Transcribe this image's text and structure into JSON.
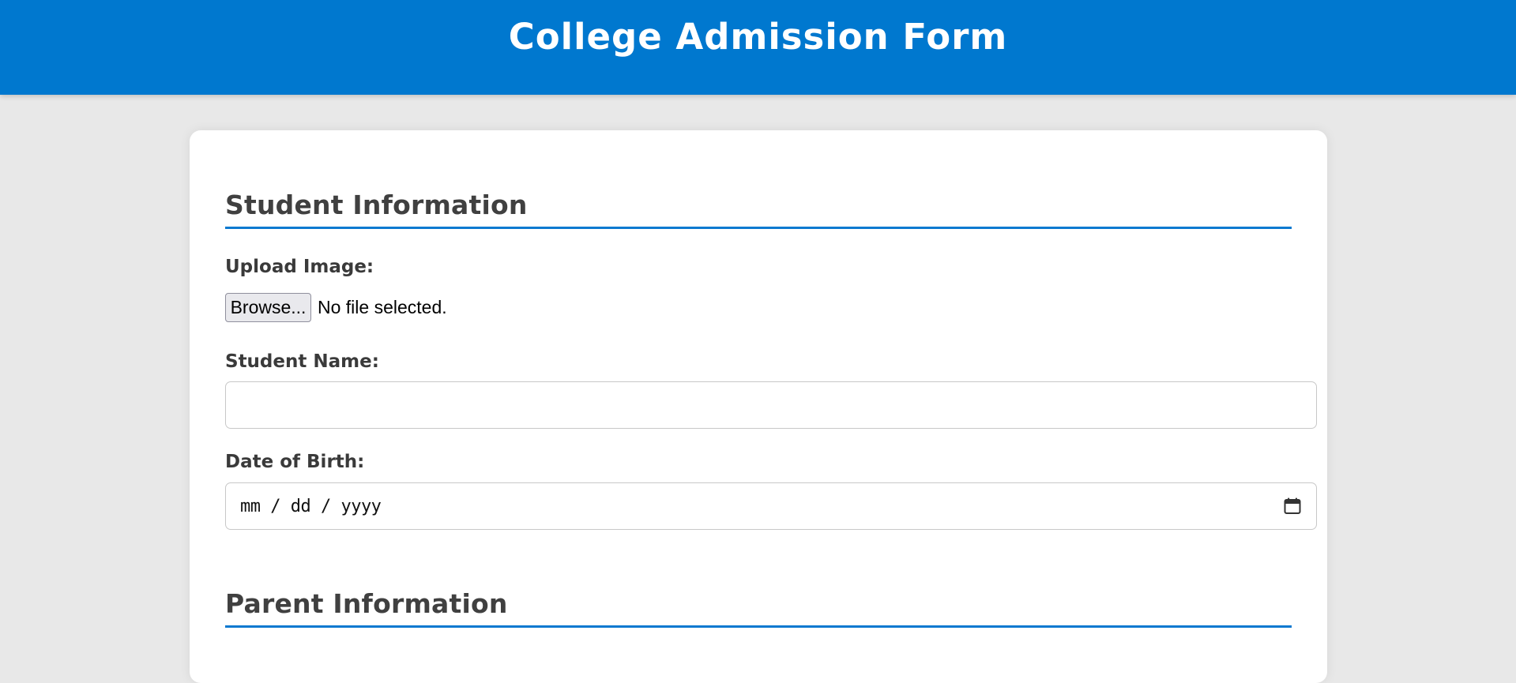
{
  "header": {
    "title": "College Admission Form",
    "background": "#0078cf"
  },
  "student_section": {
    "title": "Student Information",
    "upload": {
      "label": "Upload Image:",
      "button_label": "Browse...",
      "status": "No file selected."
    },
    "name": {
      "label": "Student Name:",
      "value": ""
    },
    "dob": {
      "label": "Date of Birth:",
      "placeholder": "mm / dd / yyyy",
      "icon": "calendar-icon"
    }
  },
  "parent_section": {
    "title": "Parent Information"
  },
  "colors": {
    "accent": "#0a79d0",
    "page_background": "#e8e8e8",
    "card_background": "#ffffff"
  }
}
